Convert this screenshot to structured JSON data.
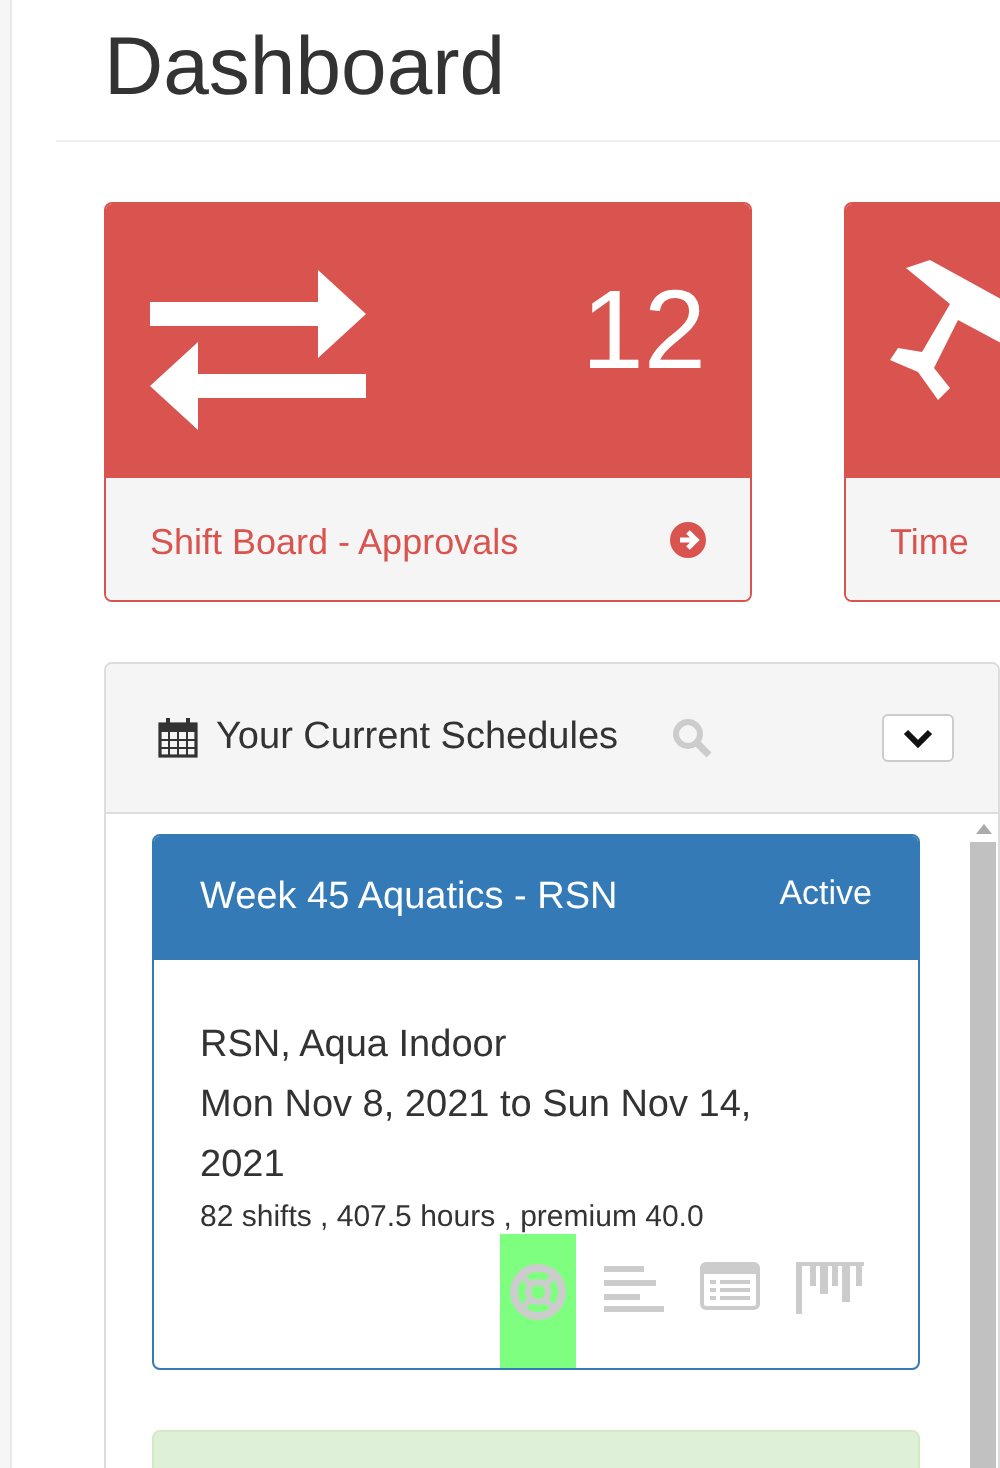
{
  "page": {
    "title": "Dashboard"
  },
  "tiles": [
    {
      "kind": "shift",
      "count": "12",
      "link": "Shift Board - Approvals",
      "link_arrow": true
    },
    {
      "kind": "timeoff",
      "link": "Time"
    }
  ],
  "schedules_panel": {
    "title": "Your Current Schedules",
    "schedules": [
      {
        "title": "Week 45 Aquatics - RSN",
        "status": "Active",
        "location": "RSN, Aqua Indoor",
        "dates": "Mon Nov 8, 2021 to Sun Nov 14, 2021",
        "stats": "82 shifts , 407.5 hours , premium 40.0",
        "actions": [
          {
            "kind": "help",
            "highlighted": true
          },
          {
            "kind": "lines",
            "highlighted": false
          },
          {
            "kind": "list",
            "highlighted": false
          },
          {
            "kind": "bars",
            "highlighted": false
          }
        ]
      }
    ]
  }
}
